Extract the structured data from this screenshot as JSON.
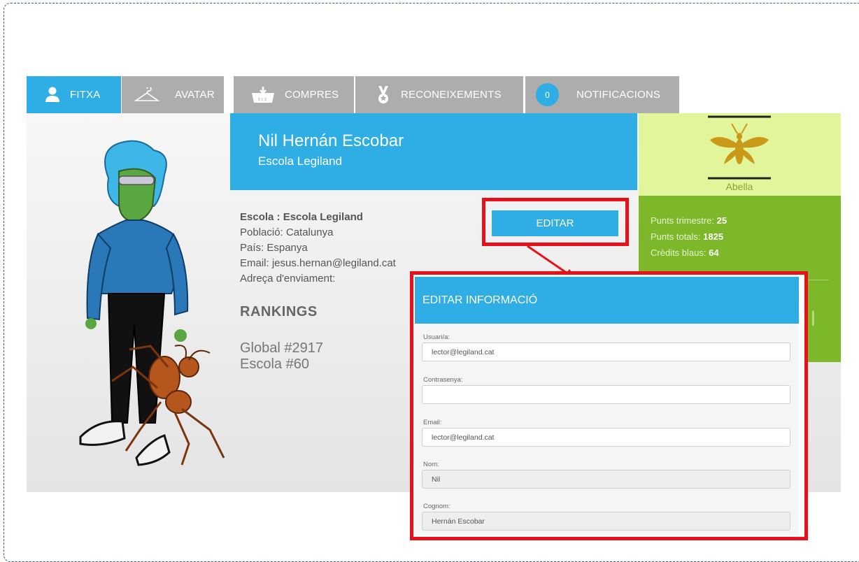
{
  "tabs": [
    {
      "label": "FITXA",
      "icon": "user-icon",
      "active": true
    },
    {
      "label": "AVATAR",
      "icon": "hanger-icon",
      "active": false
    },
    {
      "label": "COMPRES",
      "icon": "basket-icon",
      "active": false
    },
    {
      "label": "RECONEIXEMENTS",
      "icon": "medal-icon",
      "active": false
    },
    {
      "label": "NOTIFICACIONS",
      "icon": "notification-badge",
      "badge": "0",
      "active": false
    }
  ],
  "profile": {
    "name": "Nil Hernán Escobar",
    "school": "Escola Legiland",
    "info_school_label": "Escola : Escola Legiland",
    "info_city": "Població: Catalunya",
    "info_country": "País: Espanya",
    "info_email": "Email: jesus.hernan@legiland.cat",
    "info_address": "Adreça d'enviament:",
    "rankings_title": "RANKINGS",
    "rank_global": "Global #2917",
    "rank_school": "Escola #60",
    "edit_label": "EDITAR"
  },
  "level": {
    "icon": "bee-icon",
    "label": "Abella"
  },
  "points": {
    "trimester_label": "Punts trimestre:",
    "trimester_value": "25",
    "total_label": "Punts totals:",
    "total_value": "1825",
    "credits_label": "Crèdits blaus:",
    "credits_value": "64",
    "partial_text": "l"
  },
  "modal": {
    "title": "EDITAR INFORMACIÓ",
    "fields": [
      {
        "label": "Usuari/a:",
        "value": "lector@legiland.cat",
        "readonly": false
      },
      {
        "label": "Contrasenya:",
        "value": "",
        "readonly": false
      },
      {
        "label": "Email:",
        "value": "lector@legiland.cat",
        "readonly": false
      },
      {
        "label": "Nom:",
        "value": "Nil",
        "readonly": true
      },
      {
        "label": "Cognom:",
        "value": "Hernán Escobar",
        "readonly": true
      }
    ]
  },
  "colors": {
    "accent_blue": "#2eaee5",
    "tab_gray": "#adadad",
    "highlight_red": "#e8111a",
    "level_green_light": "#e3f59b",
    "points_green": "#7db82a"
  }
}
